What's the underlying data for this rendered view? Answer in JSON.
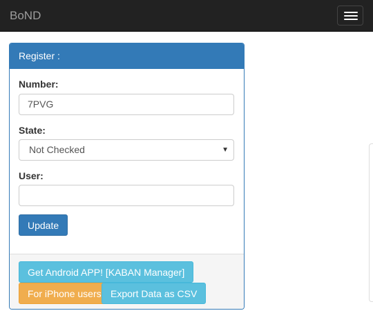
{
  "navbar": {
    "brand": "BoND",
    "menu_icon": "hamburger-menu-icon"
  },
  "panel": {
    "title": "Register :",
    "number": {
      "label": "Number:",
      "value": "7PVG"
    },
    "state": {
      "label": "State:",
      "selected": "Not Checked",
      "caret_icon": "caret-down-icon"
    },
    "user": {
      "label": "User:",
      "value": ""
    },
    "update_label": "Update"
  },
  "footer": {
    "android_label": "Get Android APP! [KABAN Manager]",
    "iphone_label": "For iPhone users",
    "export_label": "Export Data as CSV"
  },
  "colors": {
    "navbar_bg": "#222222",
    "primary": "#337ab7",
    "info": "#5bc0de",
    "warning": "#f0ad4e"
  }
}
